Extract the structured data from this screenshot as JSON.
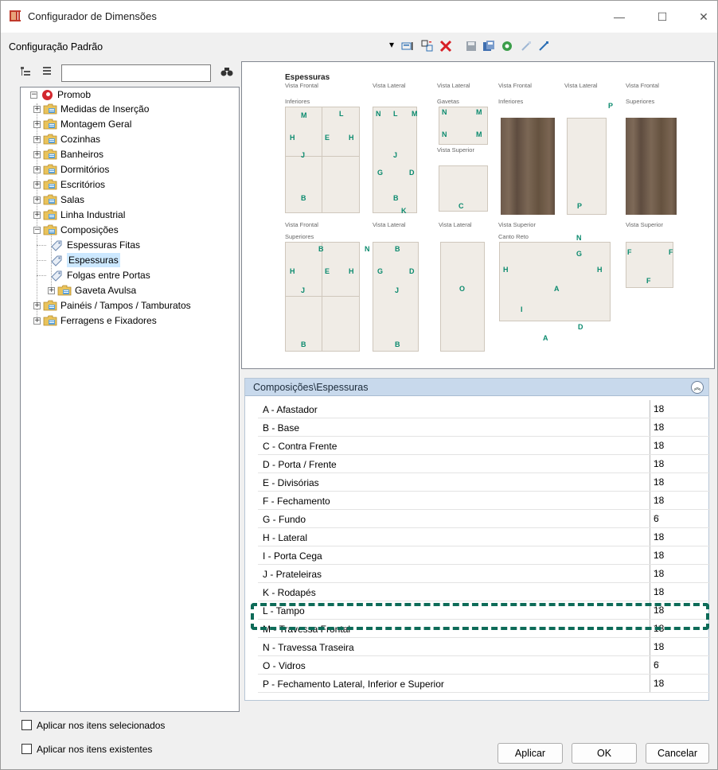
{
  "window": {
    "title": "Configurador de Dimensões",
    "minimize": "—",
    "maximize": "☐",
    "close": "✕"
  },
  "toolbar": {
    "config_label": "Configuração Padrão",
    "dropdown_arrow": "▾"
  },
  "tree": {
    "root": "Promob",
    "items": [
      {
        "label": "Medidas de Inserção"
      },
      {
        "label": "Montagem Geral"
      },
      {
        "label": "Cozinhas"
      },
      {
        "label": "Banheiros"
      },
      {
        "label": "Dormitórios"
      },
      {
        "label": "Escritórios"
      },
      {
        "label": "Salas"
      },
      {
        "label": "Linha Industrial"
      },
      {
        "label": "Composições"
      },
      {
        "label": "Espessuras Fitas"
      },
      {
        "label": "Espessuras"
      },
      {
        "label": "Folgas entre Portas"
      },
      {
        "label": "Gaveta Avulsa"
      },
      {
        "label": "Painéis / Tampos / Tamburatos"
      },
      {
        "label": "Ferragens e Fixadores"
      }
    ]
  },
  "preview": {
    "title": "Espessuras",
    "labels": {
      "vf1": "Vista Frontal",
      "vl1": "Vista Lateral",
      "vl2": "Vista Lateral",
      "vf2": "Vista Frontal",
      "vl3": "Vista Lateral",
      "vf3": "Vista Frontal",
      "inferiores": "Inferiores",
      "gavetas": "Gavetas",
      "inferiores2": "Inferiores",
      "superiores": "Superiores",
      "vista_superior": "Vista Superior",
      "vf4": "Vista Frontal",
      "vl4": "Vista Lateral",
      "vl5": "Vista Lateral",
      "vs2": "Vista Superior",
      "vs3": "Vista Superior",
      "superiores2": "Superiores",
      "canto_reto": "Canto Reto"
    }
  },
  "properties": {
    "header": "Composições\\Espessuras",
    "rows": [
      {
        "name": "A - Afastador",
        "value": "18"
      },
      {
        "name": "B - Base",
        "value": "18"
      },
      {
        "name": "C - Contra Frente",
        "value": "18"
      },
      {
        "name": "D - Porta / Frente",
        "value": "18"
      },
      {
        "name": "E - Divisórias",
        "value": "18"
      },
      {
        "name": "F - Fechamento",
        "value": "18"
      },
      {
        "name": "G - Fundo",
        "value": "6"
      },
      {
        "name": "H - Lateral",
        "value": "18"
      },
      {
        "name": "I - Porta Cega",
        "value": "18"
      },
      {
        "name": "J - Prateleiras",
        "value": "18"
      },
      {
        "name": "K - Rodapés",
        "value": "18"
      },
      {
        "name": "L - Tampo",
        "value": "18"
      },
      {
        "name": "M - Travessa Frontal",
        "value": "18"
      },
      {
        "name": "N - Travessa Traseira",
        "value": "18"
      },
      {
        "name": "O - Vidros",
        "value": "6"
      },
      {
        "name": "P - Fechamento Lateral, Inferior e Superior",
        "value": "18"
      }
    ]
  },
  "options": {
    "apply_selected": "Aplicar nos itens selecionados",
    "apply_existing": "Aplicar nos itens existentes"
  },
  "buttons": {
    "apply": "Aplicar",
    "ok": "OK",
    "cancel": "Cancelar"
  },
  "colors": {
    "accent": "#0d6b58",
    "header_bg": "#c8d9ec",
    "selection": "#cce8ff"
  }
}
